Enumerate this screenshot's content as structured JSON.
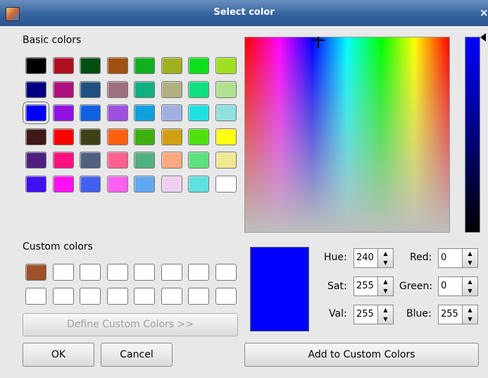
{
  "window": {
    "title": "Select color",
    "close_glyph": "×",
    "app_icon": "color-dialog-icon"
  },
  "basic": {
    "label": "Basic colors",
    "selected_index": 16,
    "colors": [
      "#000000",
      "#b01020",
      "#005010",
      "#a05010",
      "#10b020",
      "#a0b020",
      "#10e020",
      "#a0e020",
      "#000080",
      "#b01080",
      "#205080",
      "#a07080",
      "#10b080",
      "#b0b080",
      "#10e080",
      "#b0e090",
      "#0000ff",
      "#9010e0",
      "#1060e0",
      "#a050e0",
      "#10a0e0",
      "#a0b0e0",
      "#20e0e0",
      "#90e0e0",
      "#401818",
      "#ff0000",
      "#404018",
      "#ff6010",
      "#40b010",
      "#d0a010",
      "#50e010",
      "#ffff10",
      "#502080",
      "#ff1080",
      "#506080",
      "#ff6090",
      "#50b080",
      "#ffa880",
      "#60e080",
      "#f0e890",
      "#4010f0",
      "#ff10f0",
      "#4060f0",
      "#ff60f0",
      "#60a8f0",
      "#f0d0f0",
      "#60e0e0",
      "#ffffff"
    ]
  },
  "custom": {
    "label": "Custom colors",
    "colors": [
      "#a0502a",
      "#ffffff",
      "#ffffff",
      "#ffffff",
      "#ffffff",
      "#ffffff",
      "#ffffff",
      "#ffffff",
      "#ffffff",
      "#ffffff",
      "#ffffff",
      "#ffffff",
      "#ffffff",
      "#ffffff",
      "#ffffff",
      "#ffffff"
    ]
  },
  "buttons": {
    "define": "Define Custom Colors >>",
    "ok": "OK",
    "cancel": "Cancel",
    "add": "Add to Custom Colors"
  },
  "current_color": "#0000ff",
  "fields": {
    "hue": {
      "label": "Hue:",
      "value": "240"
    },
    "sat": {
      "label": "Sat:",
      "value": "255"
    },
    "val": {
      "label": "Val:",
      "value": "255"
    },
    "red": {
      "label": "Red:",
      "value": "0"
    },
    "green": {
      "label": "Green:",
      "value": "0"
    },
    "blue": {
      "label": "Blue:",
      "value": "255"
    }
  },
  "spin_glyphs": {
    "up": "▲",
    "down": "▼"
  }
}
